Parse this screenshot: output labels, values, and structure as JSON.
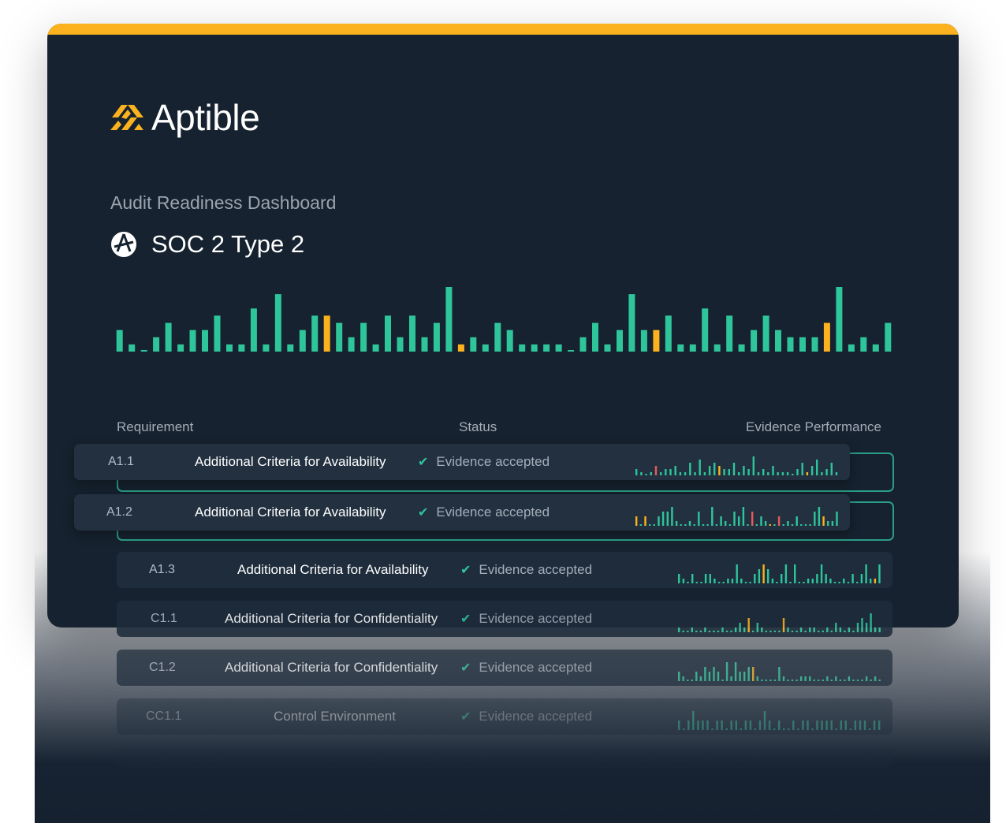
{
  "brand": {
    "name": "Aptible",
    "color": "#fbb21e"
  },
  "dashboard": {
    "title": "Audit Readiness Dashboard",
    "framework": "SOC 2 Type 2",
    "framework_icon": "soc2-seal-icon"
  },
  "colors": {
    "good": "#2fc59b",
    "warn": "#fbb21e",
    "bad": "#e45b5b",
    "panel": "#16222f"
  },
  "chart_data": {
    "type": "bar",
    "values": [
      3,
      1,
      0,
      2,
      4,
      1,
      3,
      3,
      5,
      1,
      1,
      6,
      1,
      8,
      1,
      3,
      5,
      5,
      4,
      2,
      4,
      1,
      5,
      2,
      5,
      2,
      4,
      9,
      1,
      2,
      1,
      4,
      3,
      1,
      1,
      1,
      1,
      0,
      2,
      4,
      1,
      3,
      8,
      3,
      3,
      5,
      1,
      1,
      6,
      1,
      5,
      1,
      3,
      5,
      3,
      2,
      2,
      2,
      4,
      9,
      1,
      2,
      1,
      4
    ],
    "highlight": {
      "17": "warn",
      "28": "warn",
      "44": "warn",
      "58": "warn"
    }
  },
  "table": {
    "headers": {
      "requirement": "Requirement",
      "status": "Status",
      "evidence": "Evidence Performance"
    },
    "rows": [
      {
        "code": "A1.1",
        "name": "Additional Criteria for Availability",
        "status": "Evidence accepted",
        "spark": [
          2,
          1,
          0,
          1,
          3,
          1,
          2,
          2,
          3,
          1,
          1,
          4,
          1,
          5,
          1,
          3,
          4,
          3,
          2,
          2,
          4,
          1,
          3,
          2,
          6,
          1,
          2,
          1,
          3,
          1,
          1,
          1,
          0,
          2,
          4,
          1,
          3,
          5,
          1,
          2,
          4,
          1
        ],
        "warn": [
          17,
          35
        ],
        "bad": [
          4
        ]
      },
      {
        "code": "A1.2",
        "name": "Additional Criteria for Availability",
        "status": "Evidence accepted",
        "spark": [
          2,
          0,
          2,
          0,
          0,
          2,
          3,
          3,
          4,
          1,
          0,
          0,
          1,
          0,
          3,
          0,
          0,
          4,
          0,
          2,
          1,
          0,
          3,
          2,
          4,
          0,
          3,
          0,
          2,
          1,
          0,
          0,
          2,
          0,
          1,
          0,
          2,
          0,
          0,
          0,
          3,
          4,
          2,
          1,
          1,
          3
        ],
        "warn": [
          0,
          2,
          30,
          42
        ],
        "bad": [
          26,
          32
        ]
      },
      {
        "code": "A1.3",
        "name": "Additional Criteria for Availability",
        "status": "Evidence accepted",
        "spark": [
          2,
          1,
          0,
          2,
          0,
          0,
          2,
          2,
          1,
          0,
          0,
          1,
          1,
          4,
          1,
          0,
          0,
          2,
          3,
          4,
          3,
          1,
          0,
          2,
          4,
          0,
          4,
          0,
          0,
          1,
          1,
          2,
          4,
          2,
          1,
          0,
          0,
          1,
          0,
          2,
          0,
          2,
          4,
          1,
          1,
          4
        ],
        "warn": [
          19,
          44
        ],
        "bad": []
      },
      {
        "code": "C1.1",
        "name": "Additional Criteria for Confidentiality",
        "status": "Evidence accepted",
        "spark": [
          1,
          0,
          0,
          1,
          0,
          0,
          1,
          0,
          0,
          0,
          1,
          0,
          0,
          1,
          2,
          1,
          3,
          0,
          2,
          1,
          0,
          0,
          0,
          0,
          3,
          1,
          0,
          0,
          1,
          0,
          1,
          1,
          0,
          0,
          1,
          0,
          2,
          1,
          0,
          1,
          0,
          2,
          3,
          2,
          4,
          1,
          1
        ],
        "warn": [
          16,
          24
        ],
        "bad": []
      },
      {
        "code": "C1.2",
        "name": "Additional Criteria for Confidentiality",
        "status": "Evidence accepted",
        "spark": [
          2,
          1,
          0,
          0,
          2,
          1,
          3,
          2,
          3,
          2,
          0,
          4,
          1,
          4,
          2,
          2,
          3,
          3,
          1,
          0,
          0,
          0,
          0,
          3,
          1,
          0,
          0,
          0,
          1,
          1,
          1,
          0,
          0,
          0,
          1,
          0,
          1,
          0,
          0,
          1,
          0,
          0,
          0,
          1,
          0,
          1,
          0
        ],
        "warn": [
          17
        ],
        "bad": []
      },
      {
        "code": "CC1.1",
        "name": "Control Environment",
        "status": "Evidence accepted",
        "spark": [
          1,
          0,
          1,
          2,
          1,
          1,
          1,
          0,
          1,
          1,
          0,
          1,
          1,
          0,
          1,
          1,
          0,
          1,
          2,
          1,
          0,
          1,
          0,
          0,
          1,
          0,
          1,
          1,
          0,
          1,
          1,
          1,
          1,
          0,
          1,
          1,
          0,
          1,
          1,
          1,
          0,
          1,
          1
        ],
        "warn": [],
        "bad": []
      }
    ]
  }
}
